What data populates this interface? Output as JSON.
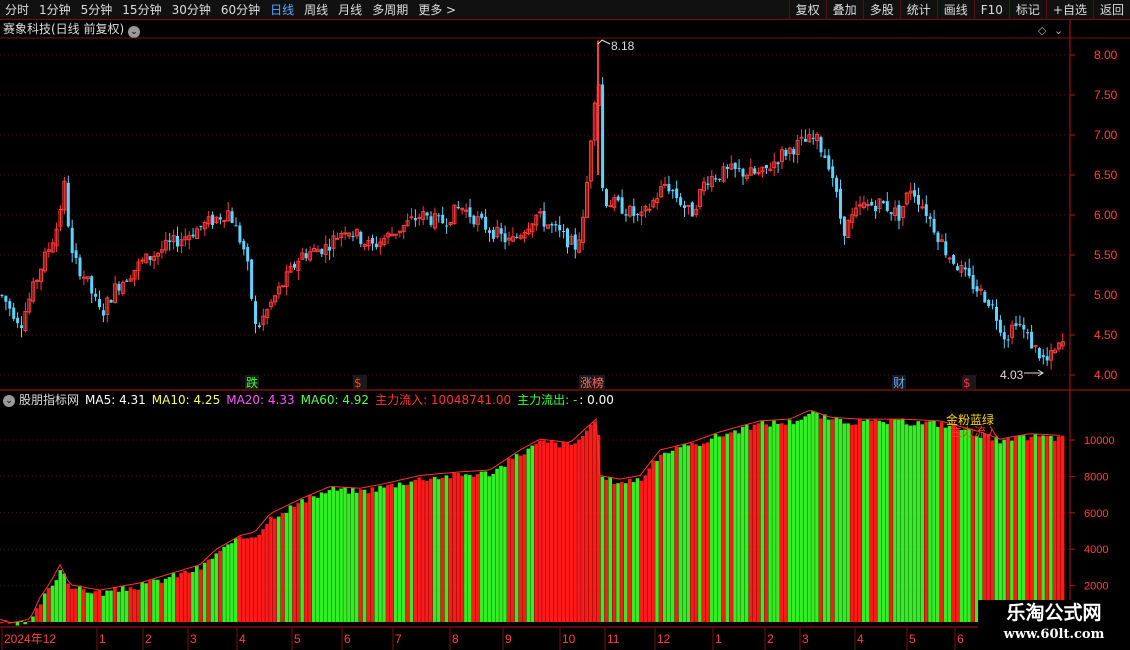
{
  "toolbar": {
    "periods": [
      "分时",
      "1分钟",
      "5分钟",
      "15分钟",
      "30分钟",
      "60分钟",
      "日线",
      "周线",
      "月线",
      "多周期",
      "更多 >"
    ],
    "active_period": "日线",
    "actions": [
      "复权",
      "叠加",
      "多股",
      "统计",
      "画线",
      "F10",
      "标记",
      "+自选",
      "返回"
    ]
  },
  "stock": {
    "title": "赛象科技(日线 前复权)"
  },
  "price_chart": {
    "y_ticks": [
      "8.00",
      "7.50",
      "7.00",
      "6.50",
      "6.00",
      "5.50",
      "5.00",
      "4.50",
      "4.00"
    ],
    "high_label": "8.18",
    "low_label": "4.03",
    "markers": [
      {
        "text": "跌",
        "color": "#33ff33"
      },
      {
        "text": "$",
        "color": "#ff3333"
      },
      {
        "text": "涨榜",
        "color": "#ff6666"
      },
      {
        "text": "财",
        "color": "#5aa9ff"
      },
      {
        "text": "$",
        "color": "#ff3333"
      }
    ],
    "colors": {
      "up": "#ff3b3b",
      "down": "#5fd3ff",
      "grid": "#7a1010"
    }
  },
  "indicator": {
    "name": "股朋指标网",
    "ma5": "MA5: 4.31",
    "ma10": "MA10: 4.25",
    "ma20": "MA20: 4.33",
    "ma60": "MA60: 4.92",
    "inflow": "主力流入: 10048741.00",
    "outflow": "主力流出: -",
    "outflow_value": ": 0.00",
    "y_ticks": [
      "10000",
      "8000",
      "6000",
      "4000",
      "2000"
    ],
    "annotation_line1": "金粉蓝绿",
    "annotation_line2": "主力流入",
    "colors": {
      "ma5": "#ffffff",
      "ma10": "#ffff55",
      "ma20": "#ff55ff",
      "ma60": "#55ff55",
      "inflow": "#ff3333",
      "outflow": "#33ff33",
      "bar_red": "#ff1a1a",
      "bar_green": "#33ee22"
    }
  },
  "x_axis": {
    "labels": [
      "2024年12",
      "1",
      "2",
      "3",
      "4",
      "5",
      "6",
      "7",
      "8",
      "9",
      "10",
      "11",
      "12",
      "1",
      "2",
      "3",
      "4",
      "5",
      "6"
    ]
  },
  "watermark": {
    "cn": "乐淘公式网",
    "url": "www.60lt.com"
  }
}
